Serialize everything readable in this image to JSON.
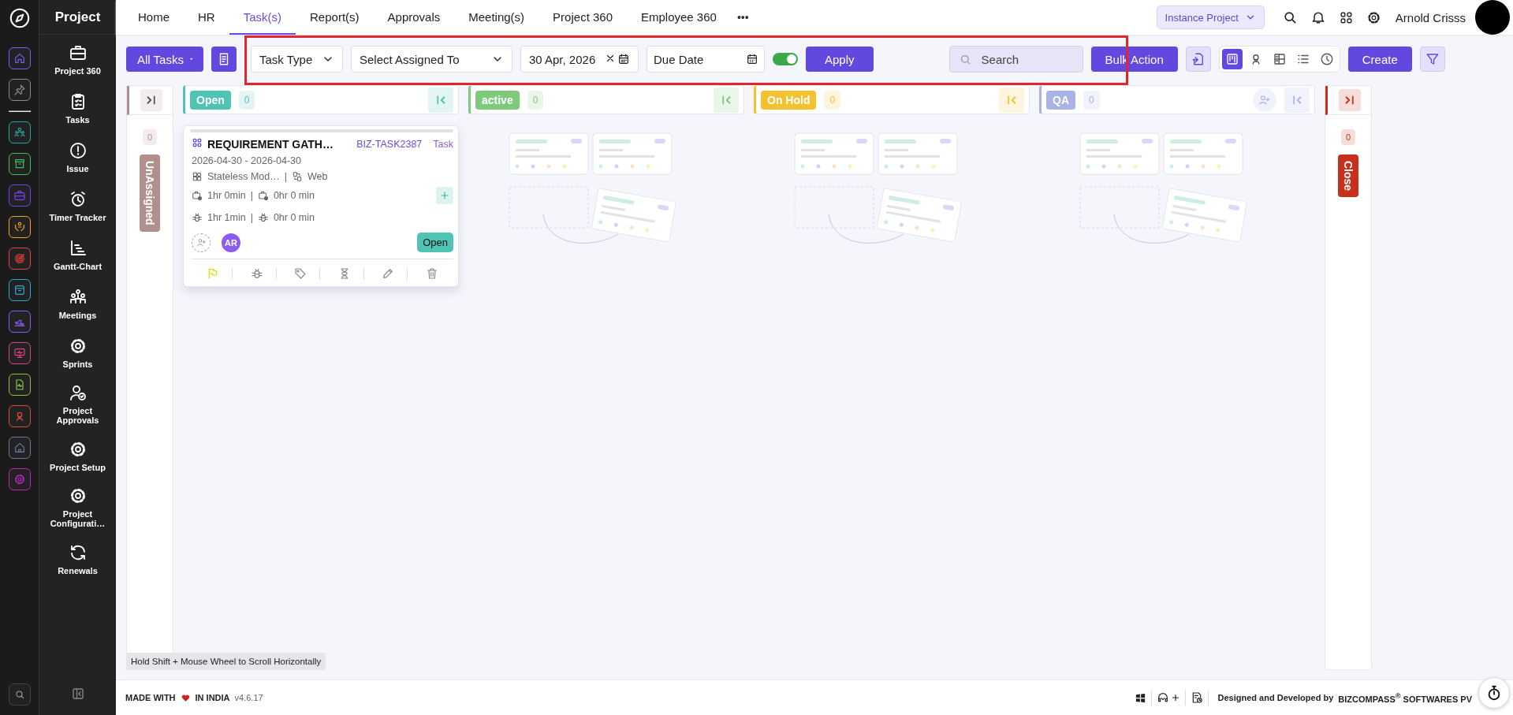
{
  "rail": {
    "items": [
      {
        "color": "#7c5cf6"
      },
      {
        "color": "#8a8a8a"
      },
      {
        "color": "#22a7a0"
      },
      {
        "color": "#3fbf4f"
      },
      {
        "color": "#7b3ff2"
      },
      {
        "color": "#f0a020"
      },
      {
        "color": "#e8403a"
      },
      {
        "color": "#2aa8d8"
      },
      {
        "color": "#8a5cf6"
      },
      {
        "color": "#e0408a"
      },
      {
        "color": "#8cc63f"
      },
      {
        "color": "#e04a3a"
      },
      {
        "color": "#6a7a9a"
      },
      {
        "color": "#c020c0"
      }
    ]
  },
  "sidebar": {
    "title": "Project",
    "items": [
      {
        "label": "Project 360"
      },
      {
        "label": "Tasks"
      },
      {
        "label": "Issue"
      },
      {
        "label": "Timer Tracker"
      },
      {
        "label": "Gantt-Chart"
      },
      {
        "label": "Meetings"
      },
      {
        "label": "Sprints"
      },
      {
        "label": "Project Approvals"
      },
      {
        "label": "Project Setup"
      },
      {
        "label": "Project Configurati…"
      },
      {
        "label": "Renewals"
      }
    ]
  },
  "nav": {
    "tabs": [
      {
        "label": "Home",
        "selected": false
      },
      {
        "label": "HR",
        "selected": false
      },
      {
        "label": "Task(s)",
        "selected": true
      },
      {
        "label": "Report(s)",
        "selected": false
      },
      {
        "label": "Approvals",
        "selected": false
      },
      {
        "label": "Meeting(s)",
        "selected": false
      },
      {
        "label": "Project 360",
        "selected": false
      },
      {
        "label": "Employee 360",
        "selected": false
      }
    ],
    "more": "•••",
    "project": "Instance Project",
    "user": "Arnold Crisss"
  },
  "toolbar": {
    "scope": "All Tasks",
    "task_type": "Task Type",
    "assigned": "Select Assigned To",
    "start_date": "30 Apr, 2026",
    "due_date": {
      "placeholder": "Due Date"
    },
    "toggle": {
      "on": true
    },
    "apply": "Apply",
    "search": {
      "placeholder": "Search"
    },
    "bulk": "Bulk Action",
    "views": [
      {
        "selected": true
      },
      {
        "selected": false
      },
      {
        "selected": false
      },
      {
        "selected": false
      },
      {
        "selected": false
      }
    ],
    "create": "Create"
  },
  "annotation": {
    "kind": "highlight-box",
    "color": "#e3262b"
  },
  "board": {
    "columns": [
      {
        "kind": "collapsed",
        "title": "UnAssigned",
        "count": "0",
        "color": "#b0908c"
      },
      {
        "kind": "lane",
        "title": "Open",
        "count": "0",
        "color": "#4fc3b4",
        "cards": [
          {
            "title": "REQUIREMENT GATH…",
            "id": "BIZ-TASK2387",
            "type": "Task",
            "dates": "2026-04-30 - 2026-04-30",
            "module": "Stateless Mod…",
            "module_sep": "|",
            "platform": "Web",
            "estimate": "1hr 0min",
            "time_sep": "|",
            "spent": "0hr 0 min",
            "bug_estimate": "1hr 1min",
            "bug_sep": "|",
            "bug_spent": "0hr 0 min",
            "assignees": [
              {
                "initials": "AR",
                "color": "#8c5cf0"
              }
            ],
            "status": "Open"
          }
        ]
      },
      {
        "kind": "lane",
        "title": "active",
        "count": "0",
        "color": "#7dcb7a"
      },
      {
        "kind": "lane",
        "title": "On Hold",
        "count": "0",
        "color": "#f5c22f"
      },
      {
        "kind": "lane",
        "title": "QA",
        "count": "0",
        "color": "#a9b3e6",
        "assign": true
      },
      {
        "kind": "collapsed",
        "title": "Close",
        "count": "0",
        "color": "#c8301e"
      }
    ],
    "hint": "Hold Shift + Mouse Wheel to Scroll Horizontally"
  },
  "footer": {
    "made": "MADE WITH",
    "india": "IN INDIA",
    "version": "v4.6.17",
    "credit": "Designed and Developed by",
    "company": "BIZCOMPASS$^{®}$ SOFTWARES PV"
  }
}
